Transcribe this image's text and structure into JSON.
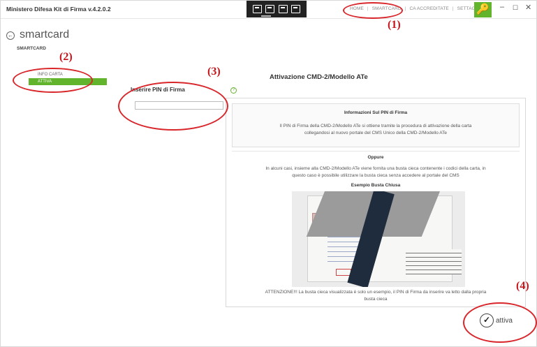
{
  "app": {
    "title": "Ministero Difesa Kit di Firma v.4.2.0.2",
    "topnav": [
      "HOME",
      "SMARTCARD",
      "CA ACCREDITATE",
      "SETTAGGI"
    ],
    "window_controls": [
      "–",
      "☐",
      "✕"
    ]
  },
  "header": {
    "back_glyph": "←",
    "title": "smartcard",
    "subtitle": "SMARTCARD"
  },
  "sidebar": {
    "items": [
      {
        "label": "INFO CARTA",
        "active": false
      },
      {
        "label": "ATTIVA",
        "active": true
      }
    ]
  },
  "form": {
    "section_title": "Attivazione CMD-2/Modello ATe",
    "pin_label": "Inserire PIN di Firma",
    "pin_value": "",
    "help_glyph": "?"
  },
  "info": {
    "heading": "Informazioni Sul PIN di Firma",
    "line1": "Il PIN di Firma della CMD-2/Modello ATe si ottiene tramite la procedura di attivazione della carta",
    "line2": "collegandosi al nuovo portale del CMS Unico della CMD-2/Modello ATe",
    "or_heading": "Oppure",
    "line3": "In alcuni casi, insieme alla CMD-2/Modello ATe viene fornita una busta cieca contenente i codici della carta, in",
    "line4": "questo caso è possibile utilizzare la busta cieca senza accedere al portale del CMS",
    "example_heading": "Esempio Busta Chiusa",
    "warning1": "ATTENZIONE!!! La busta cieca visualizzata è solo un esempio, il PIN di Firma da inserire va letto dalla propria",
    "warning2": "busta cieca"
  },
  "actions": {
    "activate_label": "attiva",
    "check_glyph": "✓"
  },
  "annotations": [
    "(1)",
    "(2)",
    "(3)",
    "(4)"
  ],
  "colors": {
    "accent": "#62b42c",
    "annotation": "#d8262a"
  }
}
